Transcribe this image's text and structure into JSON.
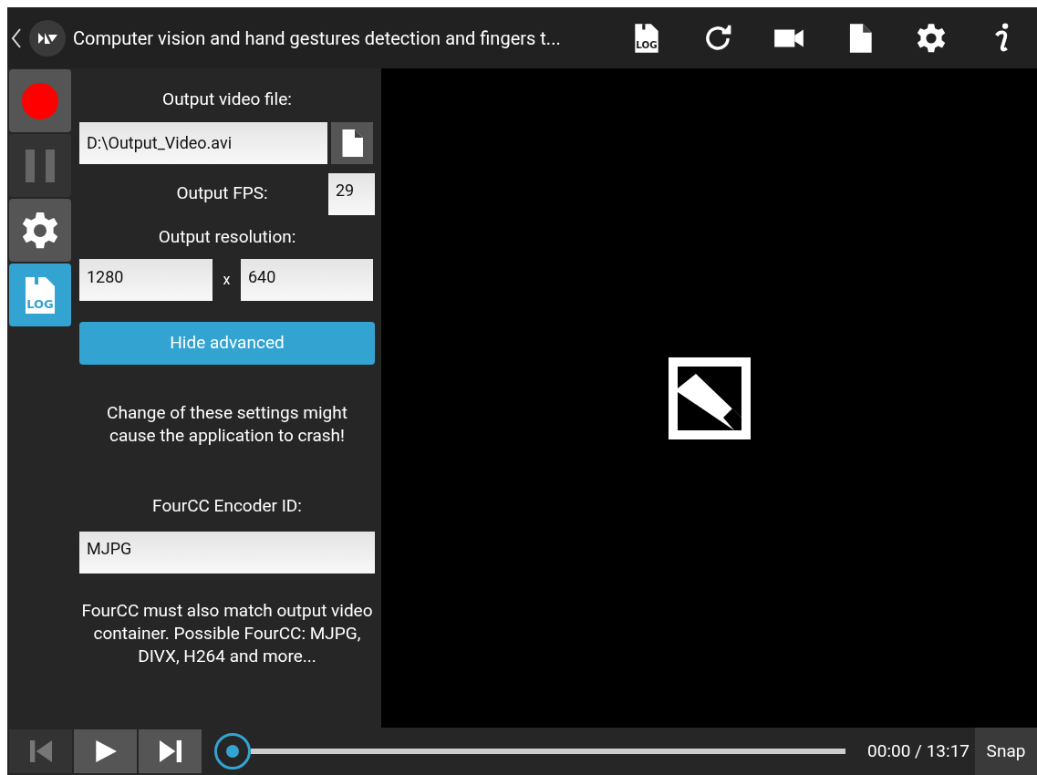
{
  "title_bar": {
    "title": "Computer vision and hand gestures detection and fingers t..."
  },
  "toolbar": [
    {
      "kind": "log",
      "label": "LOG"
    },
    {
      "kind": "refresh"
    },
    {
      "kind": "camera"
    },
    {
      "kind": "file"
    },
    {
      "kind": "settings"
    },
    {
      "kind": "info"
    }
  ],
  "sidebar": [
    {
      "kind": "record",
      "selected": false,
      "disabled": false
    },
    {
      "kind": "pause",
      "selected": false,
      "disabled": true
    },
    {
      "kind": "settings",
      "selected": false,
      "disabled": false
    },
    {
      "kind": "log",
      "label": "LOG",
      "selected": true,
      "disabled": false
    }
  ],
  "panel": {
    "file_label": "Output video file:",
    "file_value": "D:\\Output_Video.avi",
    "fps_label": "Output FPS:",
    "fps_value": "29",
    "resolution_label": "Output resolution:",
    "width_value": "1280",
    "times": "x",
    "height_value": "640",
    "advanced_button": "Hide advanced",
    "warning": "Change of these settings might cause the application to crash!",
    "fourcc_label": "FourCC Encoder ID:",
    "fourcc_value": "MJPG",
    "fourcc_note": "FourCC must also match output video container. Possible FourCC: MJPG, DIVX, H264 and more..."
  },
  "player": {
    "prev_disabled": true,
    "next_disabled": false,
    "time": "00:00 / 13:17",
    "snap": "Snap"
  }
}
